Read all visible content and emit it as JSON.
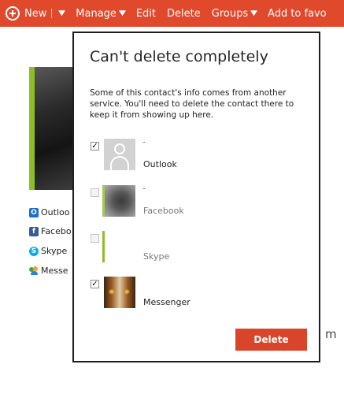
{
  "colors": {
    "bar": "#e0492c",
    "accent_green": "#8cbf26",
    "button": "#d9452b"
  },
  "topbar": {
    "new_label": "New",
    "manage_label": "Manage",
    "edit_label": "Edit",
    "delete_label": "Delete",
    "groups_label": "Groups",
    "add_favorites_label": "Add to favo"
  },
  "background": {
    "services": [
      {
        "name": "Outloo",
        "icon": "outlook-icon"
      },
      {
        "name": "Facebo",
        "icon": "facebook-icon"
      },
      {
        "name": "Skype",
        "icon": "skype-icon"
      },
      {
        "name": "Messe",
        "icon": "messenger-icon"
      }
    ],
    "trailing_text": "m"
  },
  "dialog": {
    "title": "Can't delete completely",
    "message": "Some of this contact's info comes from another service. You'll need to delete the contact there to keep it from showing up here.",
    "accounts": [
      {
        "label": "Outlook",
        "checked": true,
        "checkbox_glyph": "✓"
      },
      {
        "label": "Facebook",
        "checked": false,
        "checkbox_glyph": ""
      },
      {
        "label": "Skype",
        "checked": false,
        "checkbox_glyph": ""
      },
      {
        "label": "Messenger",
        "checked": true,
        "checkbox_glyph": "✓"
      }
    ],
    "delete_button": "Delete"
  }
}
